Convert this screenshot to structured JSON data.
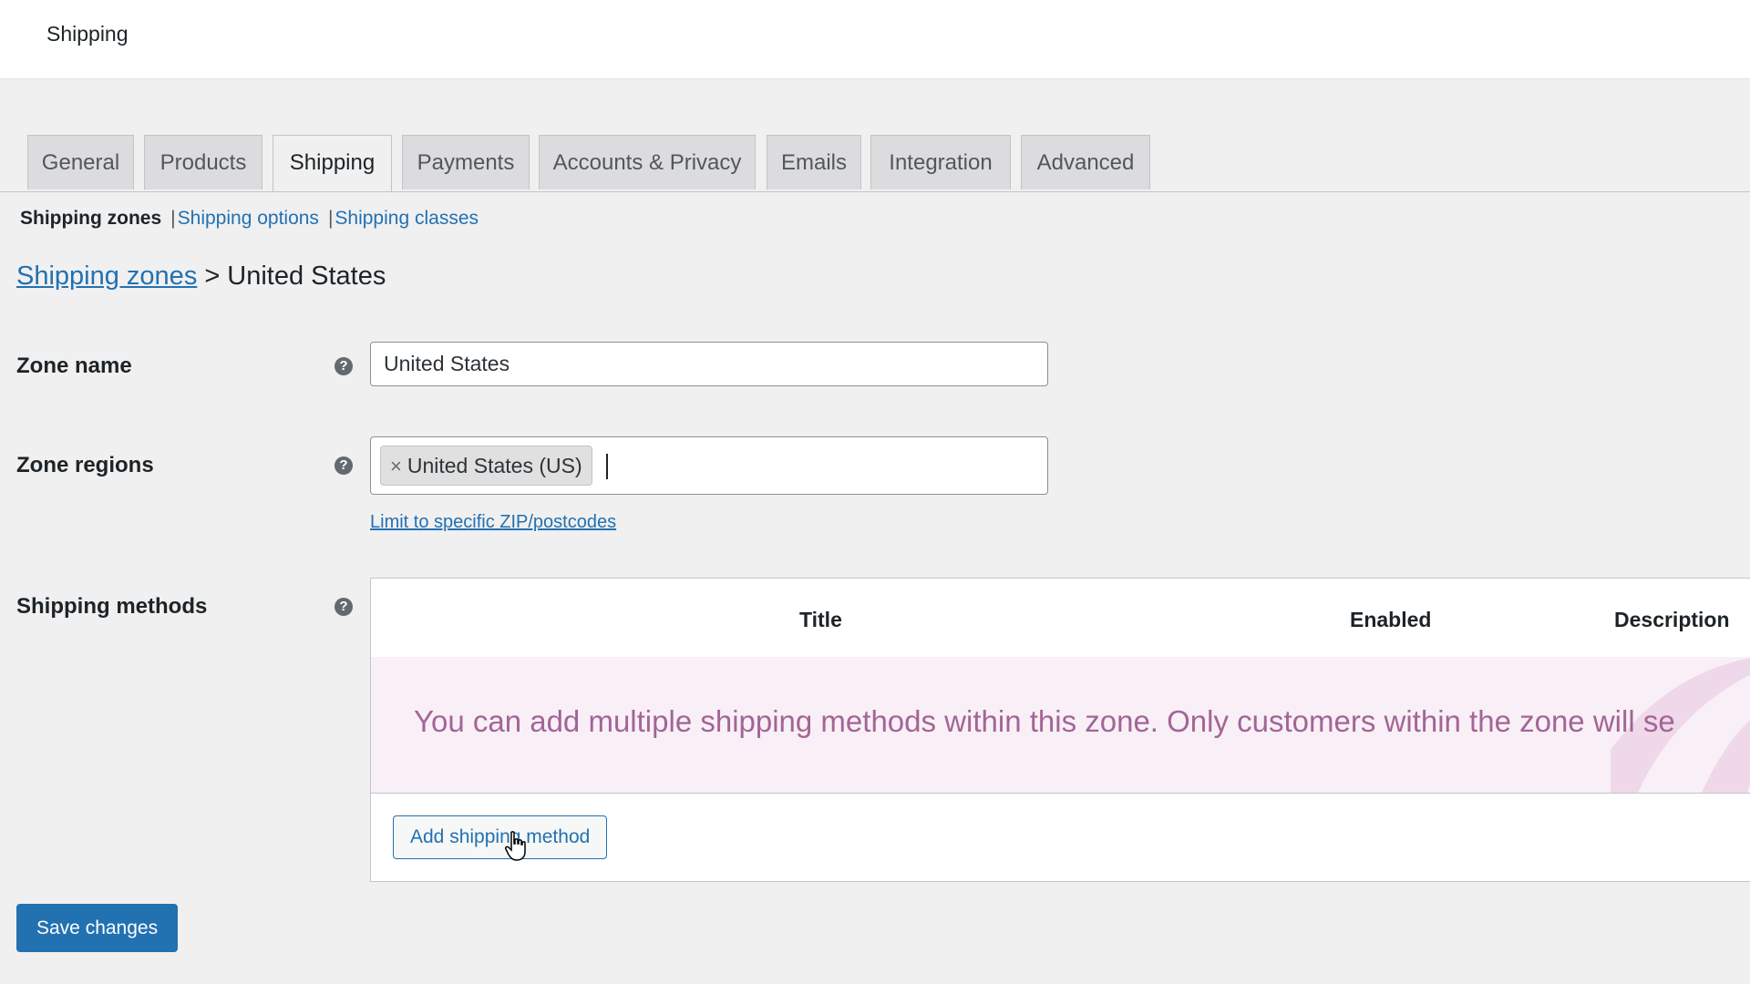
{
  "header": {
    "title": "Shipping"
  },
  "tabs": [
    {
      "label": "General"
    },
    {
      "label": "Products"
    },
    {
      "label": "Shipping",
      "active": true
    },
    {
      "label": "Payments"
    },
    {
      "label": "Accounts & Privacy"
    },
    {
      "label": "Emails"
    },
    {
      "label": "Integration"
    },
    {
      "label": "Advanced"
    }
  ],
  "subnav": {
    "current": "Shipping zones",
    "options": "Shipping options",
    "classes": "Shipping classes"
  },
  "breadcrumb": {
    "link": "Shipping zones",
    "separator": ">",
    "current": "United States"
  },
  "zone_name": {
    "label": "Zone name",
    "value": "United States"
  },
  "zone_regions": {
    "label": "Zone regions",
    "chips": [
      {
        "label": "United States (US)",
        "remove_glyph": "×"
      }
    ],
    "zip_link": "Limit to specific ZIP/postcodes"
  },
  "shipping_methods": {
    "label": "Shipping methods",
    "columns": [
      "Title",
      "Enabled",
      "Description"
    ],
    "empty_message": "You can add multiple shipping methods within this zone. Only customers within the zone will se",
    "add_button": "Add shipping method"
  },
  "help_glyph": "?",
  "save_button": "Save changes",
  "colors": {
    "accent": "#2271b1",
    "notice_bg": "#f8f0f6",
    "notice_text": "#a46497",
    "page_bg": "#f0f0f1"
  },
  "icons": [
    "help-icon",
    "remove-chip-icon",
    "hand-pointer-cursor"
  ]
}
